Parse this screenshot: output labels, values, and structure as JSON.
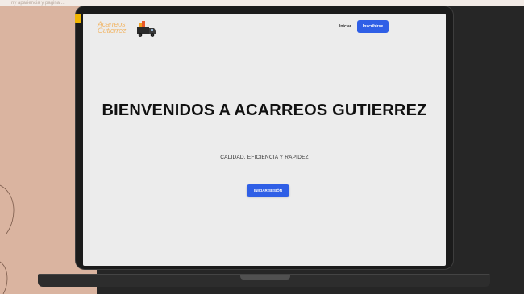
{
  "background_caption": "ny apariencia y pagina ...",
  "logo": {
    "line1": "Acarreos",
    "line2": "Gutierrez",
    "icon": "truck-icon"
  },
  "nav": {
    "login_label": "Iniciar",
    "signup_label": "Inscribirse"
  },
  "hero": {
    "title": "BIENVENIDOS A ACARREOS GUTIERREZ",
    "subtitle": "CALIDAD, EFICIENCIA Y RAPIDEZ",
    "cta_label": "INICIAR SESIÓN"
  },
  "colors": {
    "accent": "#2f5fe6",
    "screen_bg": "#ececec",
    "frame_bg": "#262626",
    "peach": "#dab4a0",
    "logo_orange": "#f1b76a"
  }
}
